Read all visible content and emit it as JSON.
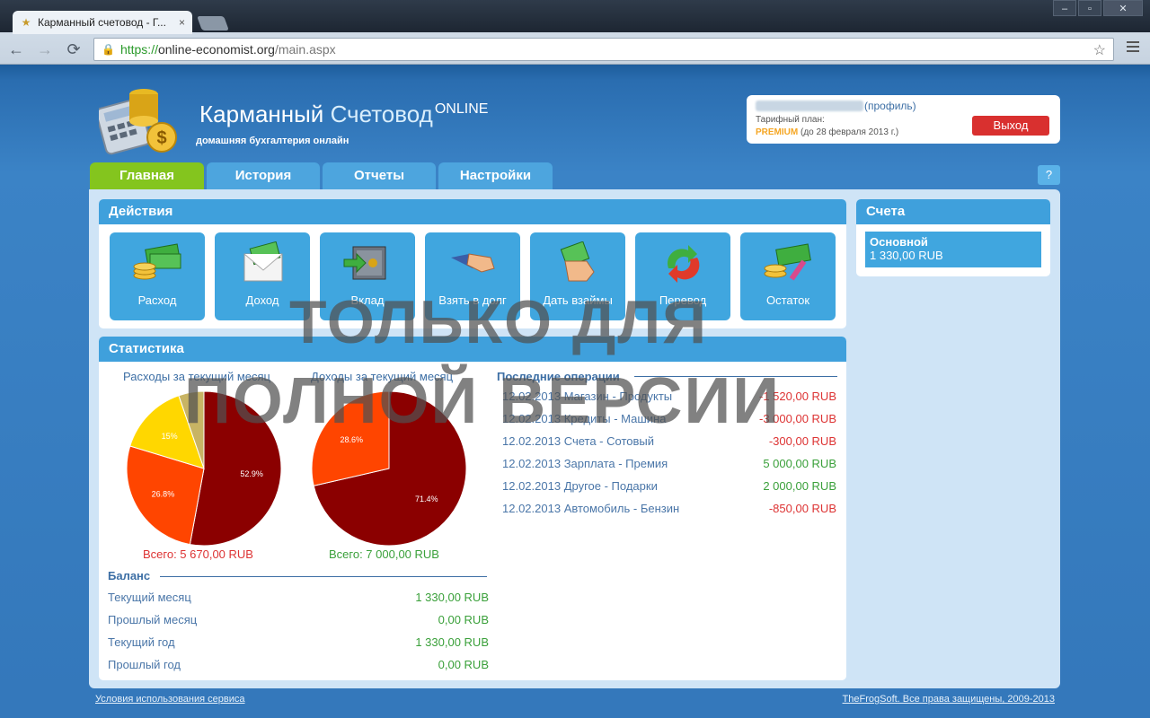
{
  "browser": {
    "tab_title": "Карманный счетовод - Г...",
    "tab_close": "×",
    "url_proto": "https://",
    "url_host": "online-economist.org",
    "url_path": "/main.aspx",
    "back_icon": "←",
    "forward_icon": "→",
    "reload_icon": "⟳",
    "star_icon": "☆",
    "min_icon": "‒",
    "max_icon": "▫",
    "close_icon": "✕"
  },
  "header": {
    "brand_part1": "Карманный ",
    "brand_part2": "Счетовод",
    "brand_sup": "ONLINE",
    "slogan": "домашняя бухгалтерия онлайн"
  },
  "user": {
    "profile_link": "(профиль)",
    "plan_label": "Тарифный план:",
    "plan_name": "PREMIUM",
    "plan_until": " (до 28 февраля 2013 г.)",
    "logout": "Выход"
  },
  "nav": {
    "tabs": [
      "Главная",
      "История",
      "Отчеты",
      "Настройки"
    ],
    "help": "?"
  },
  "actions": {
    "title": "Действия",
    "items": [
      "Расход",
      "Доход",
      "Вклад",
      "Взять в долг",
      "Дать взаймы",
      "Перевод",
      "Остаток"
    ]
  },
  "accounts": {
    "title": "Счета",
    "items": [
      {
        "name": "Основной",
        "value": "1 330,00 RUB"
      }
    ]
  },
  "stats": {
    "title": "Статистика",
    "expenses_title": "Расходы за текущий месяц",
    "income_title": "Доходы за текущий месяц",
    "expenses_total": "Всего: 5 670,00 RUB",
    "income_total": "Всего: 7 000,00 RUB",
    "balance_title": "Баланс",
    "balance": [
      {
        "label": "Текущий месяц",
        "value": "1 330,00 RUB"
      },
      {
        "label": "Прошлый месяц",
        "value": "0,00 RUB"
      },
      {
        "label": "Текущий год",
        "value": "1 330,00 RUB"
      },
      {
        "label": "Прошлый год",
        "value": "0,00 RUB"
      }
    ],
    "ops_title": "Последние операции",
    "ops": [
      {
        "date": "12.02.2013",
        "desc": "Магазин - Продукты",
        "amount": "-1 520,00 RUB",
        "sign": "neg"
      },
      {
        "date": "12.02.2013",
        "desc": "Кредиты - Машина",
        "amount": "-3 000,00 RUB",
        "sign": "neg"
      },
      {
        "date": "12.02.2013",
        "desc": "Счета - Сотовый",
        "amount": "-300,00 RUB",
        "sign": "neg"
      },
      {
        "date": "12.02.2013",
        "desc": "Зарплата - Премия",
        "amount": "5 000,00 RUB",
        "sign": "pos"
      },
      {
        "date": "12.02.2013",
        "desc": "Другое - Подарки",
        "amount": "2 000,00 RUB",
        "sign": "pos"
      },
      {
        "date": "12.02.2013",
        "desc": "Автомобиль - Бензин",
        "amount": "-850,00 RUB",
        "sign": "neg"
      }
    ]
  },
  "chart_data": [
    {
      "type": "pie",
      "title": "Расходы за текущий месяц",
      "values": [
        52.9,
        26.8,
        15,
        5.3
      ],
      "labels": [
        "52.9%",
        "26.8%",
        "15%",
        ""
      ],
      "colors": [
        "#8b0000",
        "#ff4500",
        "#ffd700",
        "#c8b464"
      ]
    },
    {
      "type": "pie",
      "title": "Доходы за текущий месяц",
      "values": [
        71.4,
        28.6
      ],
      "labels": [
        "71.4%",
        "28.6%"
      ],
      "colors": [
        "#8b0000",
        "#ff4500"
      ]
    }
  ],
  "watermark": {
    "line1": "ТОЛЬКО ДЛЯ",
    "line2": "ПОЛНОЙ ВЕРСИИ"
  },
  "footer": {
    "terms": "Условия использования сервиса",
    "copyright": "TheFrogSoft. Все права защищены, 2009-2013"
  }
}
